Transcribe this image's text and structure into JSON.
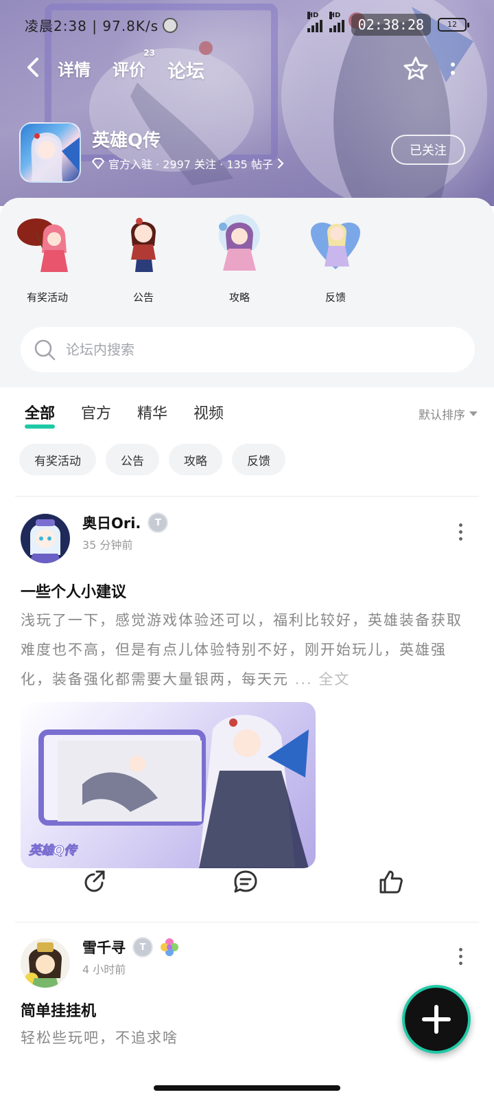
{
  "status_bar": {
    "left_text": "凌晨2:38 | 97.8K/s",
    "clock": "02:38:28",
    "battery": "12",
    "signal_label": "HD"
  },
  "nav": {
    "tabs": [
      {
        "label": "详情",
        "badge": ""
      },
      {
        "label": "评价",
        "badge": "23"
      },
      {
        "label": "论坛",
        "badge": ""
      }
    ],
    "active_tab": "论坛"
  },
  "game": {
    "name": "英雄Q传",
    "meta": "官方入驻 · 2997 关注 · 135 帖子",
    "follow_label": "已关注"
  },
  "shortcuts": [
    {
      "label": "有奖活动"
    },
    {
      "label": "公告"
    },
    {
      "label": "攻略"
    },
    {
      "label": "反馈"
    }
  ],
  "search": {
    "placeholder": "论坛内搜索"
  },
  "feed_tabs": [
    "全部",
    "官方",
    "精华",
    "视频"
  ],
  "sort_label": "默认排序",
  "filter_chips": [
    "有奖活动",
    "公告",
    "攻略",
    "反馈"
  ],
  "posts": [
    {
      "author": "奥日Ori.",
      "time": "35 分钟前",
      "title": "一些个人小建议",
      "body": "浅玩了一下，感觉游戏体验还可以，福利比较好，英雄装备获取难度也不高，但是有点儿体验特别不好，刚开始玩儿，英雄强化，装备强化都需要大量银两，每天元",
      "more_label": "... 全文",
      "image_caption": "英雄Q传"
    },
    {
      "author": "雪千寻",
      "time": "4 小时前",
      "title": "简单挂挂机",
      "body": "轻松些玩吧，不追求啥"
    }
  ],
  "colors": {
    "accent": "#20c9a6",
    "banner": "#a9a0cf",
    "panel_bg": "#f4f5f7",
    "muted_text": "#888888"
  }
}
